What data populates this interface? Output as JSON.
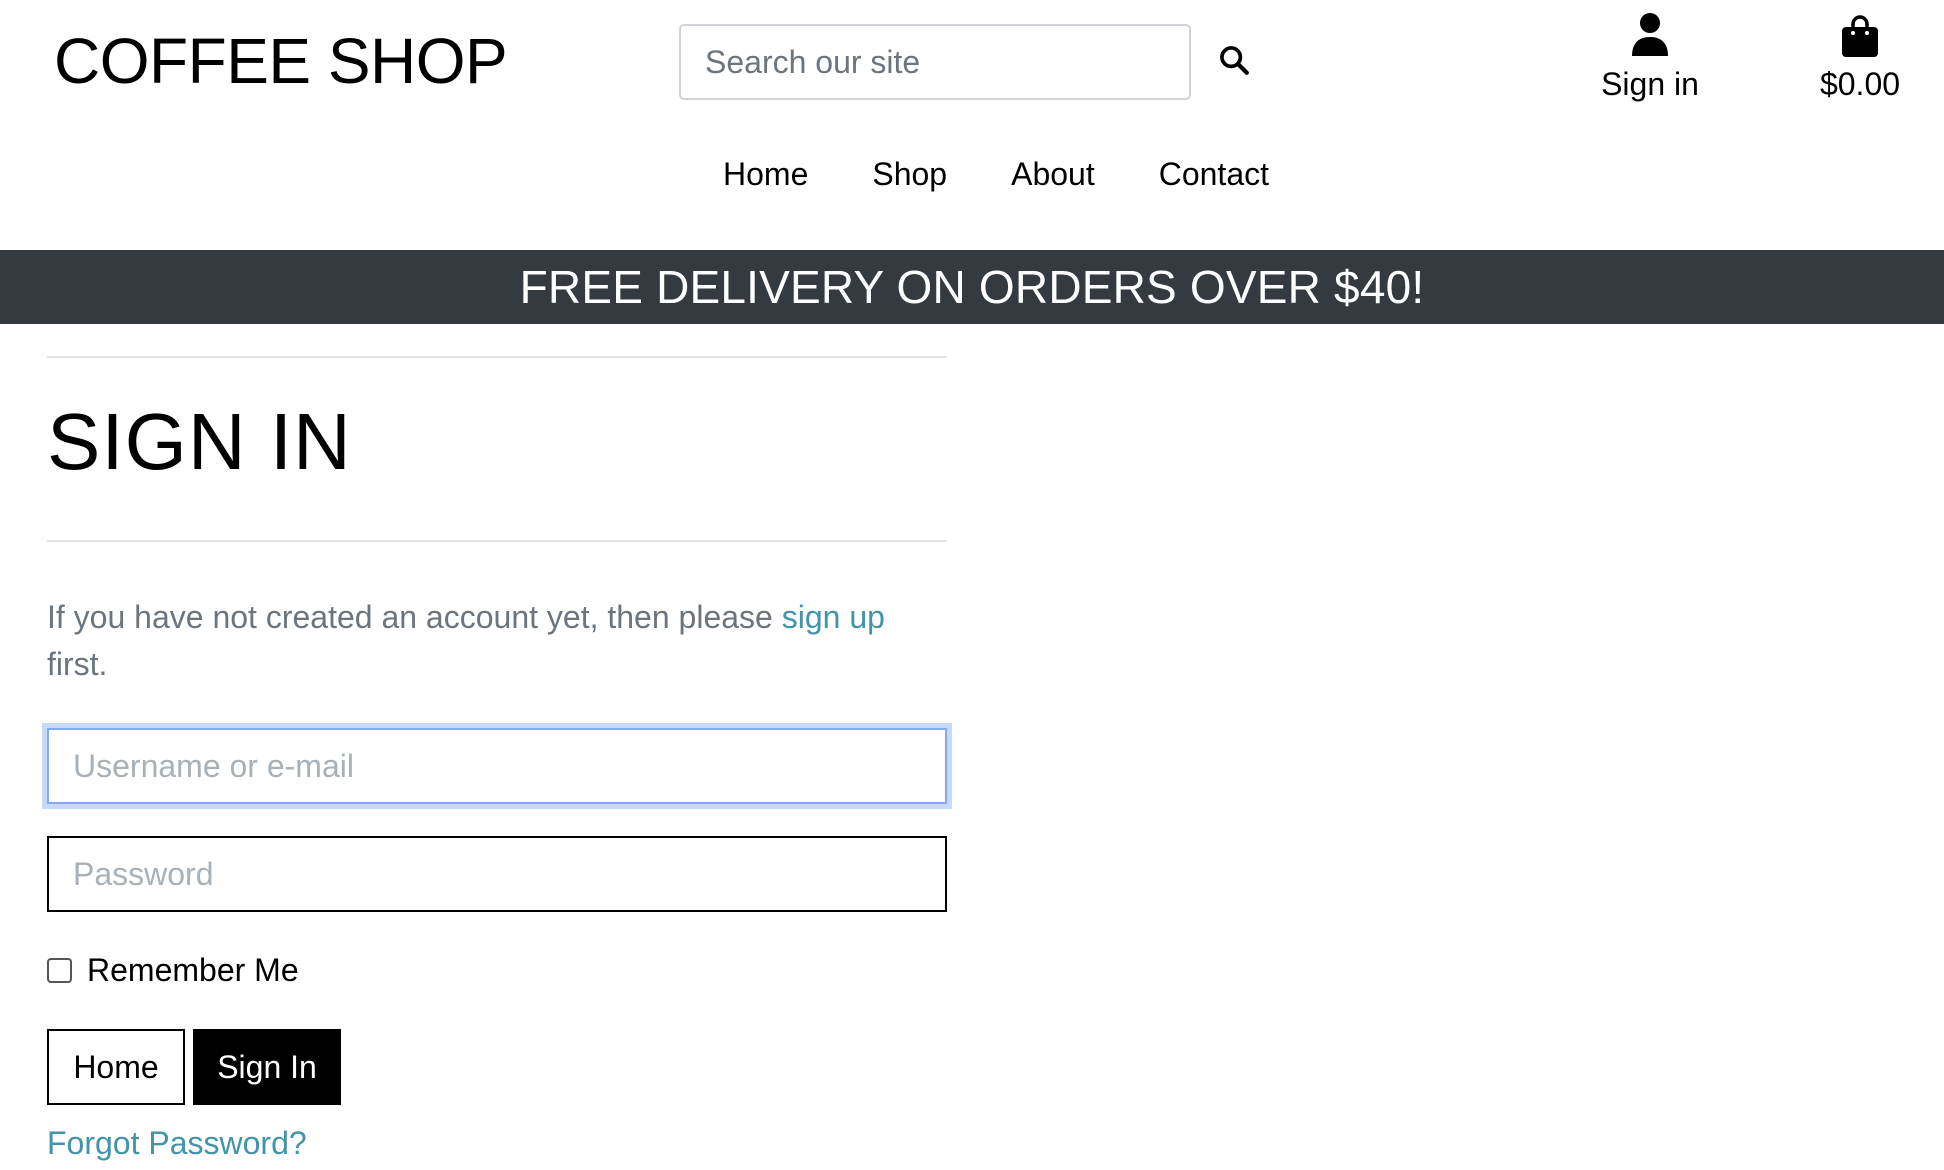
{
  "header": {
    "brand": "COFFEE SHOP",
    "search": {
      "placeholder": "Search our site",
      "icon": "search-icon"
    },
    "account": {
      "label": "Sign in",
      "icon": "user-icon"
    },
    "bag": {
      "total": "$0.00",
      "icon": "shopping-bag-icon"
    }
  },
  "nav": {
    "items": [
      "Home",
      "Shop",
      "About",
      "Contact"
    ]
  },
  "banner": {
    "text": "FREE DELIVERY ON ORDERS OVER $40!"
  },
  "signin": {
    "title": "SIGN IN",
    "intro_before": "If you have not created an account yet, then please ",
    "signup_link": "sign up",
    "intro_after": " first.",
    "username_placeholder": "Username or e-mail",
    "password_placeholder": "Password",
    "remember_label": "Remember Me",
    "remember_checked": false,
    "home_button": "Home",
    "signin_button": "Sign In",
    "forgot_link": "Forgot Password?"
  },
  "colors": {
    "banner_bg": "#343a40",
    "link": "#4194aa",
    "muted_text": "#6c757d",
    "focus_border": "#80aaf6"
  }
}
